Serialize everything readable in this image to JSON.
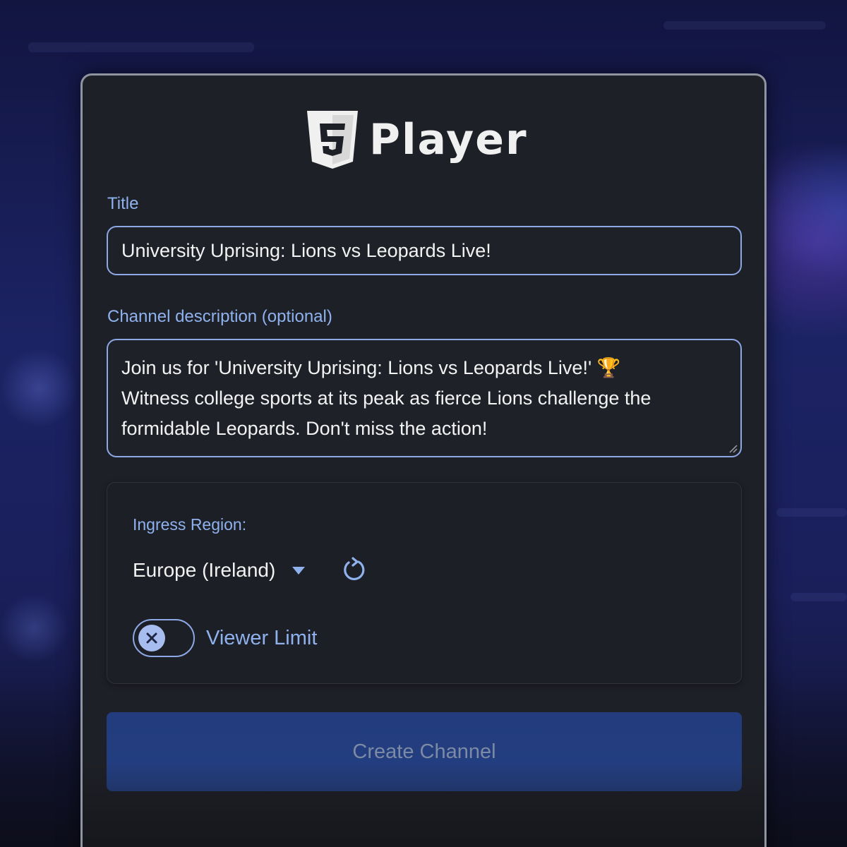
{
  "brand": {
    "logo_icon": "html5-shield-icon",
    "logo_digit": "5",
    "name": "Player"
  },
  "form": {
    "title_label": "Title",
    "title_value": "University Uprising: Lions vs Leopards Live!",
    "description_label": "Channel description (optional)",
    "description_value": "Join us for 'University Uprising: Lions vs Leopards Live!' 🏆\nWitness college sports at its peak as fierce Lions challenge the\nformidable Leopards. Don't miss the action!",
    "ingress_region_label": "Ingress Region:",
    "ingress_region_value": "Europe (Ireland)",
    "viewer_limit_label": "Viewer Limit",
    "viewer_limit_enabled": false,
    "create_button_label": "Create Channel"
  },
  "colors": {
    "accent": "#8fb2ee",
    "card_background": "#1e2027",
    "button_background": "#223c7d"
  }
}
